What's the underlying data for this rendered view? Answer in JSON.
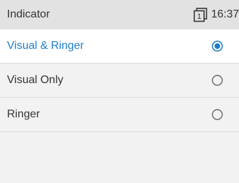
{
  "status_bar": {
    "title": "Indicator",
    "line_icon": "line-1-icon",
    "line_number": "1",
    "time": "16:37"
  },
  "options": [
    {
      "label": "Visual & Ringer",
      "selected": true
    },
    {
      "label": "Visual Only",
      "selected": false
    },
    {
      "label": "Ringer",
      "selected": false
    }
  ],
  "colors": {
    "accent": "#1d7dc7",
    "status_bar_bg": "#e2e2e2",
    "background": "#f2f2f2",
    "text": "#333333",
    "radio_unselected": "#666666"
  }
}
